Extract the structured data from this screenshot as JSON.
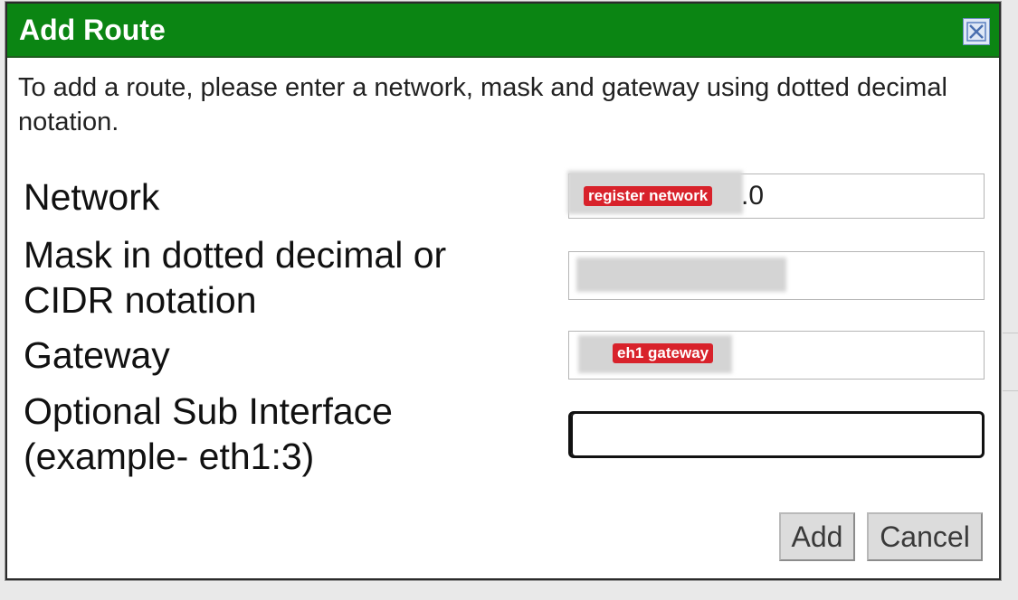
{
  "dialog": {
    "title": "Add Route",
    "close_icon": "close-x-icon",
    "instructions": "To add a route, please enter a network, mask and gateway using dotted decimal notation."
  },
  "form": {
    "network": {
      "label": "Network",
      "value_suffix": ".0",
      "redaction_tag": "register network"
    },
    "mask": {
      "label_line1": "Mask in dotted decimal or",
      "label_line2": "CIDR notation"
    },
    "gateway": {
      "label": "Gateway",
      "redaction_tag": "eh1 gateway"
    },
    "sub_interface": {
      "label_line1": "Optional Sub Interface",
      "label_line2": "(example- eth1:3)",
      "value": ""
    }
  },
  "buttons": {
    "add": "Add",
    "cancel": "Cancel"
  },
  "colors": {
    "titlebar": "#0b8513",
    "redaction": "#d8222b"
  }
}
